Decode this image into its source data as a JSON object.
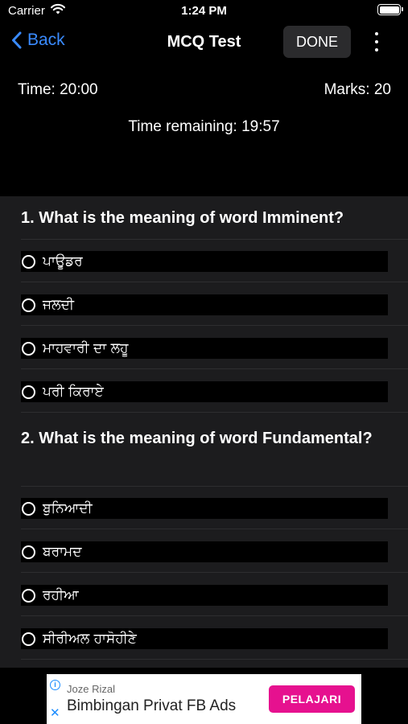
{
  "status_bar": {
    "carrier": "Carrier",
    "time": "1:24 PM"
  },
  "nav": {
    "back_label": "Back",
    "title": "MCQ Test",
    "done_label": "DONE"
  },
  "test_info": {
    "time_total": "Time: 20:00",
    "marks": "Marks: 20",
    "time_remaining": "Time remaining: 19:57"
  },
  "questions": [
    {
      "text": "1. What is the meaning of word Imminent?",
      "options": [
        "ਪਾਊਡਰ",
        "ਜਲਦੀ",
        "ਮਾਹਵਾਰੀ ਦਾ ਲਹੂ",
        "ਪਰੀ ਕਿਰਾਏ"
      ]
    },
    {
      "text": "2. What is the meaning of word Fundamental?",
      "options": [
        "ਬੁਨਿਆਦੀ",
        "ਬਰਾਮਦ",
        "ਰਹੀਆ",
        "ਸੀਰੀਅਲ ਹਾਸੋਹੀਣੇ"
      ]
    }
  ],
  "ad": {
    "advertiser": "Joze Rizal",
    "headline": "Bimbingan Privat FB Ads",
    "cta": "PELAJARI"
  },
  "colors": {
    "accent": "#3a8bff",
    "panel": "#1c1c1e",
    "cta": "#e6118f"
  }
}
